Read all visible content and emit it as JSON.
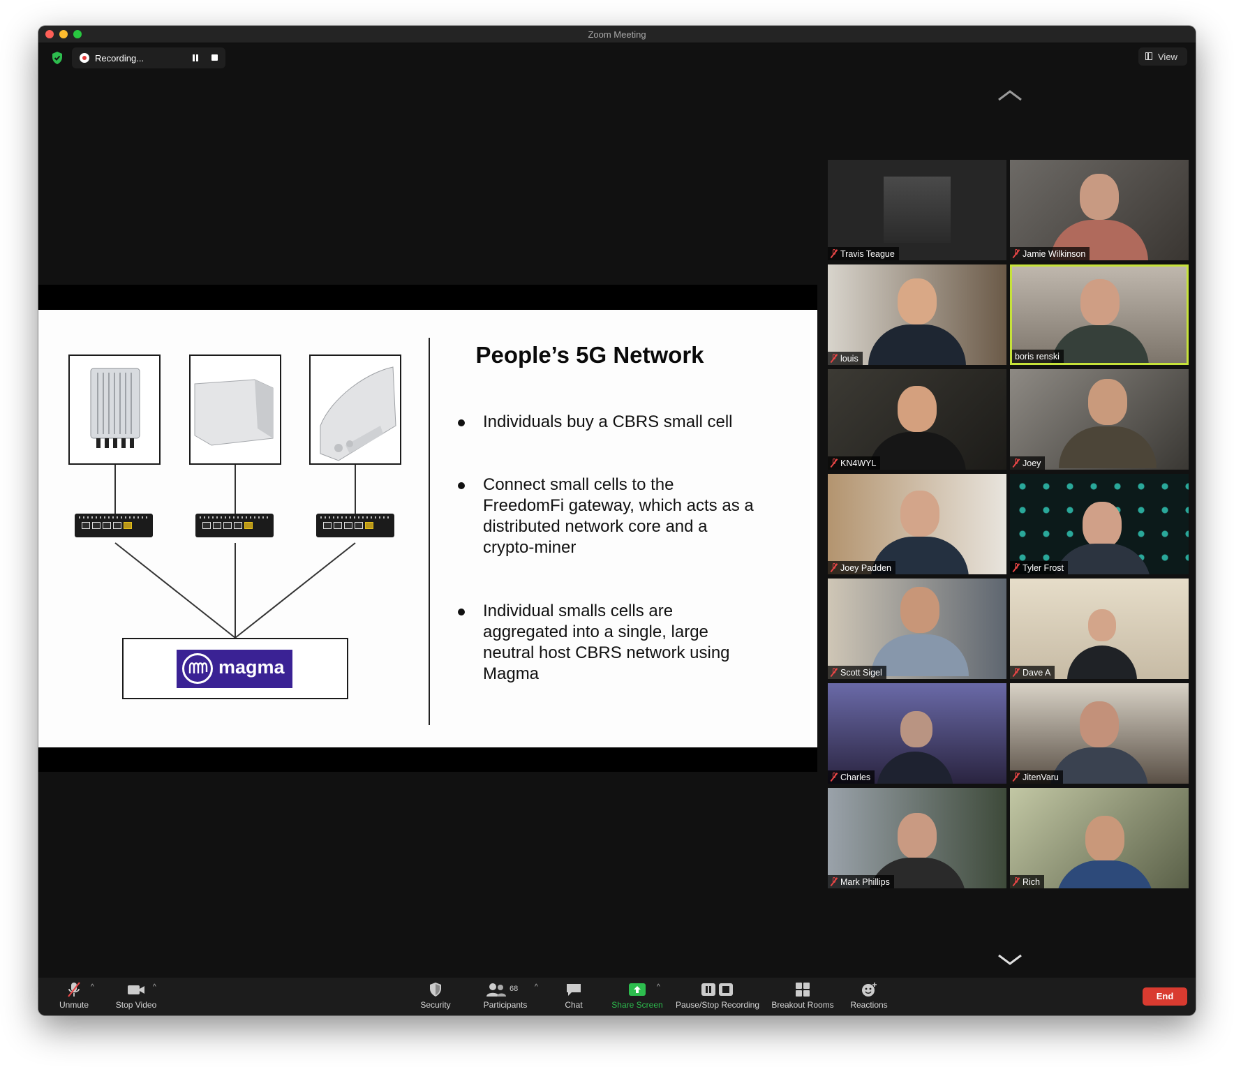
{
  "window": {
    "title": "Zoom Meeting"
  },
  "recording": {
    "label": "Recording..."
  },
  "view_button": {
    "label": "View"
  },
  "slide": {
    "title": "People’s 5G Network",
    "logo_text": "magma",
    "bullets": [
      "Individuals buy a CBRS small cell",
      "Connect small cells to the\nFreedomFi gateway, which acts as a\ndistributed network core and a\ncrypto-miner",
      "Individual smalls cells are\naggregated into a single, large\nneutral host CBRS network using\nMagma"
    ]
  },
  "participants": [
    {
      "name": "Travis Teague",
      "muted": true
    },
    {
      "name": "Jamie Wilkinson",
      "muted": true
    },
    {
      "name": "louis",
      "muted": true
    },
    {
      "name": "boris renski",
      "muted": false,
      "active_speaker": true
    },
    {
      "name": "KN4WYL",
      "muted": true
    },
    {
      "name": "Joey",
      "muted": true
    },
    {
      "name": "Joey Padden",
      "muted": true
    },
    {
      "name": "Tyler Frost",
      "muted": true
    },
    {
      "name": "Scott Sigel",
      "muted": true
    },
    {
      "name": "Dave A",
      "muted": true
    },
    {
      "name": "Charles",
      "muted": true
    },
    {
      "name": "JitenVaru",
      "muted": true
    },
    {
      "name": "Mark Phillips",
      "muted": true
    },
    {
      "name": "Rich",
      "muted": true
    }
  ],
  "toolbar": {
    "unmute": "Unmute",
    "stop_video": "Stop Video",
    "security": "Security",
    "participants": "Participants",
    "participants_count": "68",
    "chat": "Chat",
    "share_screen": "Share Screen",
    "pause_stop_recording": "Pause/Stop Recording",
    "breakout_rooms": "Breakout Rooms",
    "reactions": "Reactions",
    "end": "End"
  },
  "colors": {
    "accent_green": "#2dbd4e",
    "end_red": "#d93b30",
    "active_speaker_border": "#c6e23a",
    "magma_purple": "#3a2294"
  }
}
